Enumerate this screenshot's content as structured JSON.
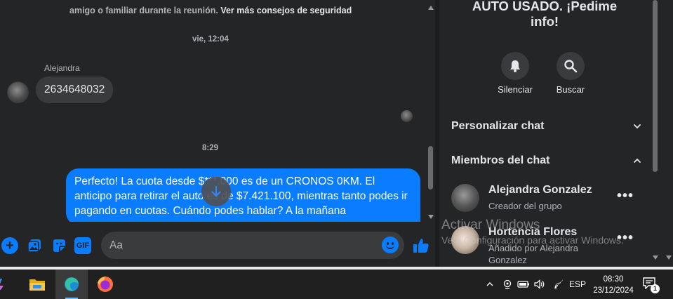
{
  "chat": {
    "safety_notice": "amigo o familiar durante la reunión.",
    "safety_link": "Ver más consejos de seguridad",
    "timestamp_1": "vie, 12:04",
    "sender_name": "Alejandra",
    "incoming_message": "2634648032",
    "timestamp_2": "8:29",
    "outgoing_message": "Perfecto! La cuota desde $***.000 es de un CRONOS 0KM. El anticipo para retirar el auto es de $7.421.100, mientras tanto podes ir pagando en cuotas. Cuándo podes hablar? A la mañana"
  },
  "composer": {
    "placeholder": "Aa",
    "gif_label": "GIF",
    "plus_label": "+"
  },
  "info_panel": {
    "title": "AUTO USADO. ¡Pedime info!",
    "actions": [
      {
        "label": "Silenciar",
        "icon": "bell-icon"
      },
      {
        "label": "Buscar",
        "icon": "search-icon"
      }
    ],
    "sections": {
      "customize": "Personalizar chat",
      "members": "Miembros del chat"
    },
    "members": [
      {
        "name": "Alejandra Gonzalez",
        "role": "Creador del grupo"
      },
      {
        "name": "Hortencia Flores",
        "role": "Añadido por Alejandra Gonzalez"
      }
    ],
    "more_label": "•••"
  },
  "watermark": {
    "line1": "Activar Windows",
    "line2": "Ve a Configuración para activar Windows."
  },
  "taskbar": {
    "apps": [
      "copilot-icon",
      "file-explorer-icon",
      "edge-icon",
      "firefox-icon"
    ],
    "language": "ESP",
    "time": "08:30",
    "date": "23/12/2024",
    "notification_count": "1"
  },
  "colors": {
    "background": "#242526",
    "bubble_out": "#0a7cff",
    "bubble_in": "#3a3b3c",
    "accent": "#0a7cff"
  }
}
